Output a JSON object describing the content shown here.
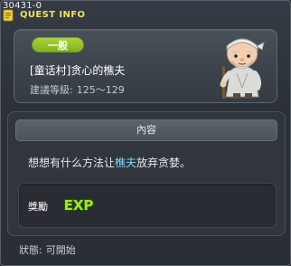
{
  "window": {
    "quest_id": "30431-0",
    "title": "QUEST INFO"
  },
  "header": {
    "category": "一般",
    "quest_name": "[童话村]贪心的樵夫",
    "level_label": "建議等級:",
    "level_range": "125～129",
    "npc_icon": "old-woodcutter-npc-icon"
  },
  "content": {
    "section_title": "內容",
    "description_prefix": "想想有什么方法让",
    "description_npc": "樵夫",
    "description_suffix": "放弃贪婪。",
    "reward_label": "獎勵",
    "reward_icon": "exp-icon",
    "reward_text": "EXP"
  },
  "status": {
    "label": "狀態:",
    "value": "可開始"
  },
  "colors": {
    "title": "#f3e05a",
    "category_badge": "#98c62c",
    "npc_link": "#7fd9f2",
    "exp_green": "#9bea20"
  }
}
